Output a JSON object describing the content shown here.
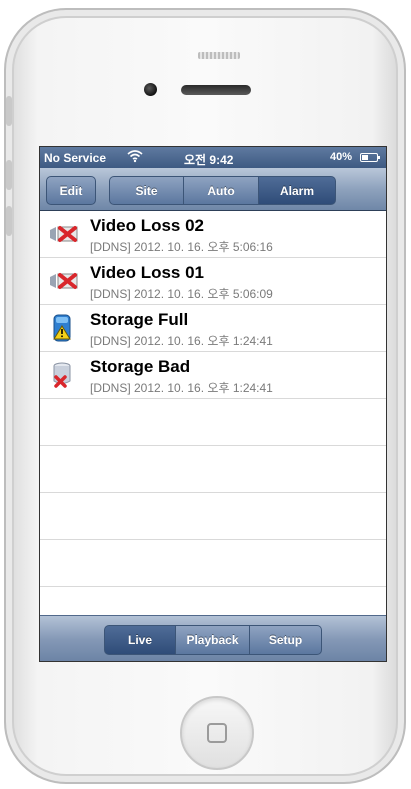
{
  "status_bar": {
    "carrier": "No Service",
    "time": "오전 9:42",
    "battery": "40%"
  },
  "toolbar": {
    "edit_label": "Edit",
    "segments": [
      "Site",
      "Auto",
      "Alarm"
    ],
    "selected_segment": "Alarm"
  },
  "alarms": [
    {
      "title": "Video Loss 02",
      "detail": "[DDNS] 2012. 10. 16. 오후 5:06:16",
      "icon": "video-loss-icon"
    },
    {
      "title": "Video Loss 01",
      "detail": "[DDNS] 2012. 10. 16. 오후 5:06:09",
      "icon": "video-loss-icon"
    },
    {
      "title": "Storage Full",
      "detail": "[DDNS] 2012. 10. 16. 오후 1:24:41",
      "icon": "storage-full-warning-icon"
    },
    {
      "title": "Storage Bad",
      "detail": "[DDNS] 2012. 10. 16. 오후 1:24:41",
      "icon": "storage-bad-icon"
    }
  ],
  "tabbar": {
    "tabs": [
      "Live",
      "Playback",
      "Setup"
    ],
    "selected_tab": "Live"
  },
  "colors": {
    "bar_blue": "#6f87a8",
    "selected_blue": "#2f4c78",
    "alert_red": "#d9262b",
    "warning_yellow": "#f3d21a"
  }
}
